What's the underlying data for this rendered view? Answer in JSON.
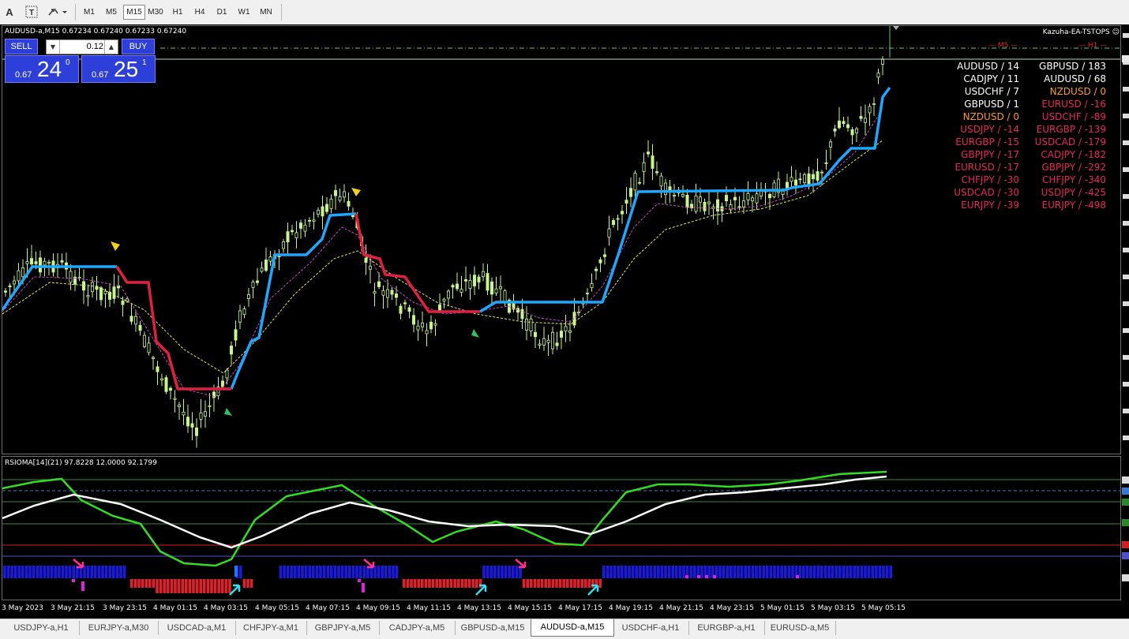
{
  "toolbar": {
    "timeframes": [
      "M1",
      "M5",
      "M15",
      "M30",
      "H1",
      "H4",
      "D1",
      "W1",
      "MN"
    ],
    "active_timeframe": "M15"
  },
  "chart": {
    "title": "AUDUSD-a,M15  0.67234 0.67240 0.67233 0.67240",
    "ea_name": "Kazuha-EA-TSTOPS ☺",
    "level_m5": "— M5 —",
    "level_h1": "— H1 —"
  },
  "trade_panel": {
    "sell_label": "SELL",
    "buy_label": "BUY",
    "lot": "0.12",
    "sell_prefix": "0.67",
    "sell_big": "24",
    "sell_sup": "0",
    "buy_prefix": "0.67",
    "buy_big": "25",
    "buy_sup": "1"
  },
  "strength_left": [
    {
      "text": "AUDUSD / 14",
      "color": "#ffffff"
    },
    {
      "text": "CADJPY / 11",
      "color": "#ffffff"
    },
    {
      "text": "USDCHF / 7",
      "color": "#ffffff"
    },
    {
      "text": "GBPUSD / 1",
      "color": "#ffffff"
    },
    {
      "text": "NZDUSD / 0",
      "color": "#ff9a1f"
    },
    {
      "text": "USDJPY / -14",
      "color": "#e8265c"
    },
    {
      "text": "EURGBP / -15",
      "color": "#e8265c"
    },
    {
      "text": "GBPJPY / -17",
      "color": "#e8265c"
    },
    {
      "text": "EURUSD / -17",
      "color": "#e8265c"
    },
    {
      "text": "CHFJPY / -30",
      "color": "#e8265c"
    },
    {
      "text": "USDCAD / -30",
      "color": "#e8265c"
    },
    {
      "text": "EURJPY / -39",
      "color": "#e8265c"
    }
  ],
  "strength_right": [
    {
      "text": "GBPUSD / 183",
      "color": "#ffffff"
    },
    {
      "text": "AUDUSD / 68",
      "color": "#ffffff"
    },
    {
      "text": "NZDUSD / 0",
      "color": "#ff9a1f"
    },
    {
      "text": "EURUSD / -16",
      "color": "#e8265c"
    },
    {
      "text": "USDCHF / -89",
      "color": "#e8265c"
    },
    {
      "text": "EURGBP / -139",
      "color": "#e8265c"
    },
    {
      "text": "USDCAD / -179",
      "color": "#e8265c"
    },
    {
      "text": "CADJPY / -182",
      "color": "#e8265c"
    },
    {
      "text": "GBPJPY / -292",
      "color": "#e8265c"
    },
    {
      "text": "CHFJPY / -340",
      "color": "#e8265c"
    },
    {
      "text": "USDJPY / -425",
      "color": "#e8265c"
    },
    {
      "text": "EURJPY / -498",
      "color": "#e8265c"
    }
  ],
  "indicator": {
    "title": "RSIOMA[14](21) 97.8228 12.0000 92.1799"
  },
  "time_labels": [
    "3 May 2023",
    "3 May 21:15",
    "3 May 23:15",
    "4 May 01:15",
    "4 May 03:15",
    "4 May 05:15",
    "4 May 07:15",
    "4 May 09:15",
    "4 May 11:15",
    "4 May 13:15",
    "4 May 15:15",
    "4 May 17:15",
    "4 May 19:15",
    "4 May 21:15",
    "4 May 23:15",
    "5 May 01:15",
    "5 May 03:15",
    "5 May 05:15"
  ],
  "tabs": [
    "USDJPY-a,H1",
    "EURJPY-a,M30",
    "USDCAD-a,M1",
    "CHFJPY-a,M1",
    "GBPJPY-a,M5",
    "CADJPY-a,M5",
    "GBPUSD-a,M15",
    "AUDUSD-a,M15",
    "USDCHF-a,H1",
    "EURGBP-a,H1",
    "EURUSD-a,M5"
  ],
  "active_tab": "AUDUSD-a,M15",
  "colors": {
    "candle": "#c8f58a",
    "stop_up": "#1ea7ff",
    "stop_down": "#e0203f",
    "rsi_green": "#33dd22",
    "rsi_white": "#ffffff",
    "hist_blue": "#1a1adf",
    "hist_red": "#e0202a"
  }
}
